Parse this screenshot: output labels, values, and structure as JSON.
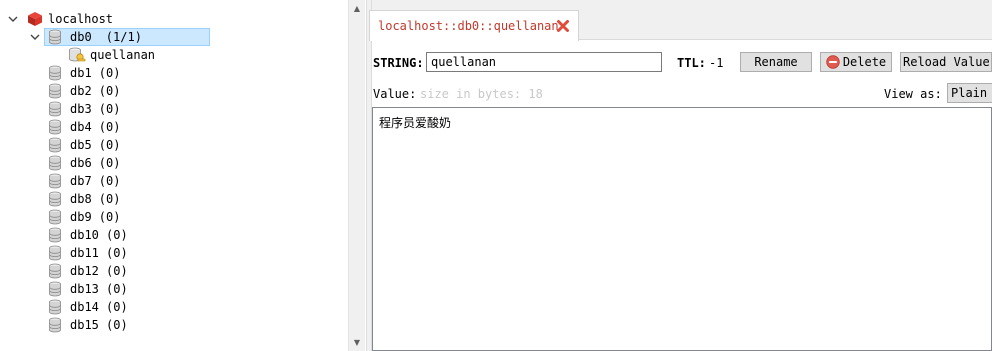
{
  "tree": {
    "server": {
      "label": "localhost",
      "expanded": true
    },
    "databases": [
      {
        "name": "db0",
        "count": "(1/1)",
        "expanded": true,
        "selected": true,
        "keys": [
          {
            "name": "quellanan"
          }
        ]
      },
      {
        "name": "db1",
        "count": "(0)"
      },
      {
        "name": "db2",
        "count": "(0)"
      },
      {
        "name": "db3",
        "count": "(0)"
      },
      {
        "name": "db4",
        "count": "(0)"
      },
      {
        "name": "db5",
        "count": "(0)"
      },
      {
        "name": "db6",
        "count": "(0)"
      },
      {
        "name": "db7",
        "count": "(0)"
      },
      {
        "name": "db8",
        "count": "(0)"
      },
      {
        "name": "db9",
        "count": "(0)"
      },
      {
        "name": "db10",
        "count": "(0)"
      },
      {
        "name": "db11",
        "count": "(0)"
      },
      {
        "name": "db12",
        "count": "(0)"
      },
      {
        "name": "db13",
        "count": "(0)"
      },
      {
        "name": "db14",
        "count": "(0)"
      },
      {
        "name": "db15",
        "count": "(0)"
      }
    ]
  },
  "tab": {
    "title": "localhost::db0::quellanan",
    "close_icon": "close-icon"
  },
  "key_panel": {
    "type_label": "STRING:",
    "key_name": "quellanan",
    "ttl_label": "TTL:",
    "ttl_value": "-1",
    "rename_label": "Rename",
    "delete_label": "Delete",
    "reload_label": "Reload Value",
    "value_label": "Value:",
    "value_hint": "size in bytes: 18",
    "view_as_label": "View as:",
    "view_as_value": "Plain",
    "value_text": "程序员爱酸奶"
  },
  "colors": {
    "tab_text": "#c0392b",
    "selection": "#cce8ff",
    "server_icon": "#d9362b",
    "delete_icon": "#e05a4f"
  }
}
